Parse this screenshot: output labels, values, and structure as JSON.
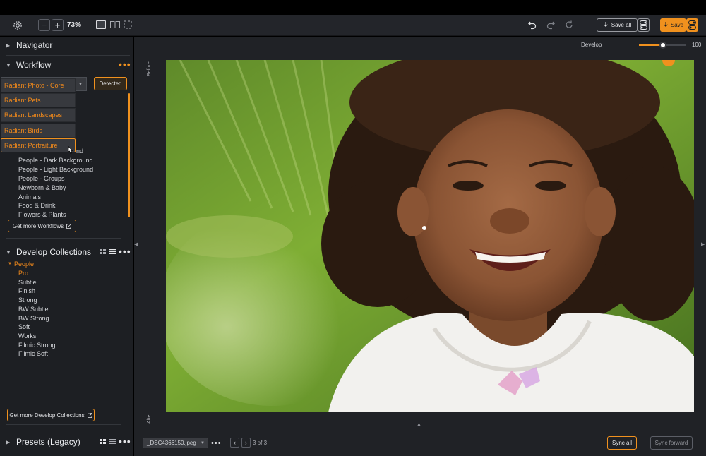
{
  "toolbar": {
    "zoom": "73%",
    "save_all_label": "Save all",
    "save_label": "Save"
  },
  "develop": {
    "label": "Develop",
    "value": "100",
    "level": 1.0
  },
  "navigator": {
    "title": "Navigator"
  },
  "workflow": {
    "title": "Workflow",
    "selected": "Radiant Photo - Core",
    "detected_label": "Detected",
    "dropdown_options": [
      "Radiant Photo - Core",
      "Radiant Pets",
      "Radiant Landscapes",
      "Radiant Birds",
      "Radiant Portraiture"
    ],
    "partial_item_suffix": "nd",
    "items": [
      "People - Dark Background",
      "People - Light Background",
      "People - Groups",
      "Newborn & Baby",
      "Animals",
      "Food & Drink",
      "Flowers & Plants"
    ],
    "get_more_label": "Get more Workflows"
  },
  "develop_collections": {
    "title": "Develop Collections",
    "group": "People",
    "items": [
      "Pro",
      "Subtle",
      "Finish",
      "Strong",
      "BW Subtle",
      "BW Strong",
      "Soft",
      "Works",
      "Filmic Strong",
      "Filmic Soft"
    ],
    "active_item": "Pro",
    "get_more_label": "Get more Develop Collections"
  },
  "presets": {
    "title": "Presets (Legacy)"
  },
  "compare": {
    "before_label": "Before",
    "after_label": "After"
  },
  "filmstrip": {
    "filename": "_DSC4366150.jpeg",
    "counter": "3 of 3",
    "sync_all_label": "Sync all",
    "sync_forward_label": "Sync forward"
  },
  "colors": {
    "accent": "#f0911e",
    "accent_text": "#f28a1b",
    "panel": "#1d1f23",
    "toolbar": "#23252a"
  },
  "icons": [
    "gear-icon",
    "minus-icon",
    "plus-icon",
    "single-view-icon",
    "split-view-icon",
    "crop-view-icon",
    "undo-icon",
    "redo-icon",
    "reset-icon",
    "download-icon",
    "toggle-icon",
    "external-link-icon",
    "grid-icon",
    "list-icon",
    "chevron-left-icon",
    "chevron-right-icon"
  ]
}
